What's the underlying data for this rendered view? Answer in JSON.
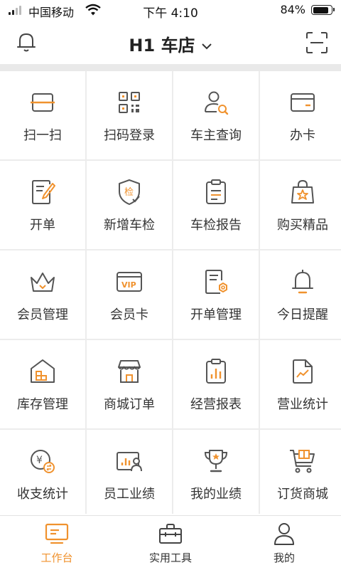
{
  "status": {
    "carrier": "中国移动",
    "time": "下午 4:10",
    "battery": "84%",
    "battery_level": 0.84
  },
  "header": {
    "store": "H1 车店"
  },
  "colors": {
    "accent": "#f0922e",
    "icon": "#555555"
  },
  "grid": {
    "items": [
      {
        "label": "扫一扫",
        "icon": "scan-icon"
      },
      {
        "label": "扫码登录",
        "icon": "qr-code-icon"
      },
      {
        "label": "车主查询",
        "icon": "user-search-icon"
      },
      {
        "label": "办卡",
        "icon": "card-icon"
      },
      {
        "label": "开单",
        "icon": "edit-document-icon"
      },
      {
        "label": "新增车检",
        "icon": "shield-check-icon"
      },
      {
        "label": "车检报告",
        "icon": "clipboard-report-icon"
      },
      {
        "label": "购买精品",
        "icon": "shopping-bag-star-icon"
      },
      {
        "label": "会员管理",
        "icon": "crown-icon"
      },
      {
        "label": "会员卡",
        "icon": "vip-card-icon"
      },
      {
        "label": "开单管理",
        "icon": "document-settings-icon"
      },
      {
        "label": "今日提醒",
        "icon": "bell-icon"
      },
      {
        "label": "库存管理",
        "icon": "warehouse-icon"
      },
      {
        "label": "商城订单",
        "icon": "store-icon"
      },
      {
        "label": "经营报表",
        "icon": "report-chart-icon"
      },
      {
        "label": "营业统计",
        "icon": "trend-document-icon"
      },
      {
        "label": "收支统计",
        "icon": "money-exchange-icon"
      },
      {
        "label": "员工业绩",
        "icon": "staff-performance-icon"
      },
      {
        "label": "我的业绩",
        "icon": "trophy-icon"
      },
      {
        "label": "订货商城",
        "icon": "cart-icon"
      }
    ]
  },
  "tabs": [
    {
      "label": "工作台",
      "icon": "monitor-icon",
      "active": true
    },
    {
      "label": "实用工具",
      "icon": "toolbox-icon",
      "active": false
    },
    {
      "label": "我的",
      "icon": "person-icon",
      "active": false
    }
  ]
}
